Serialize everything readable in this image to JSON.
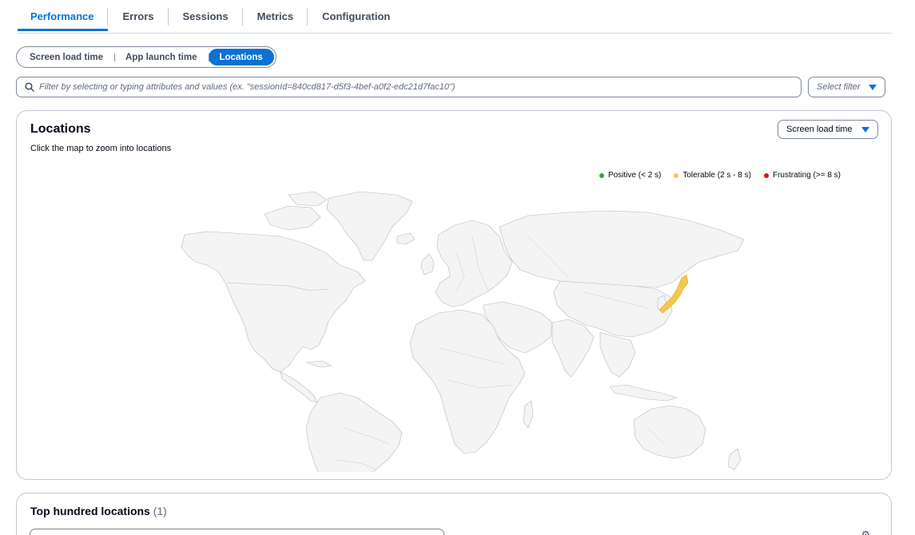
{
  "tabs": [
    {
      "label": "Performance",
      "active": true
    },
    {
      "label": "Errors"
    },
    {
      "label": "Sessions"
    },
    {
      "label": "Metrics"
    },
    {
      "label": "Configuration"
    }
  ],
  "segments": [
    {
      "label": "Screen load time"
    },
    {
      "label": "App launch time"
    },
    {
      "label": "Locations",
      "active": true
    }
  ],
  "filter": {
    "placeholder": "Filter by selecting or typing attributes and values (ex. \"sessionId=840cd817-d5f3-4bef-a0f2-edc21d7fac10\")",
    "select_label": "Select filter"
  },
  "locations": {
    "title": "Locations",
    "description": "Click the map to zoom into locations",
    "metric_select": "Screen load time",
    "legend": [
      {
        "label": "Positive (< 2 s)",
        "color": "#29ad32"
      },
      {
        "label": "Tolerable (2 s - 8 s)",
        "color": "#f2c94c"
      },
      {
        "label": "Frustrating (>= 8 s)",
        "color": "#d91515"
      }
    ],
    "highlighted_country": {
      "name": "Japan",
      "status": "Tolerable",
      "color": "#f2c94c"
    }
  },
  "top_locations": {
    "title": "Top hundred locations",
    "count": "(1)"
  },
  "colors": {
    "accent": "#0972d3",
    "land": "#f4f4f4",
    "border": "#c6c6cd"
  }
}
